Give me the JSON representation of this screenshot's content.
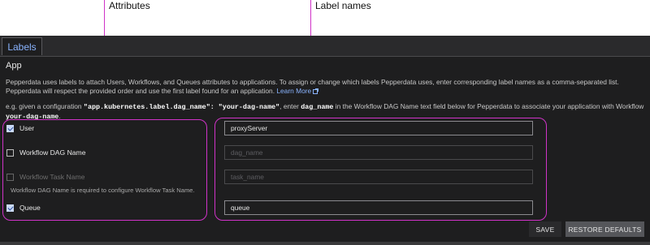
{
  "callouts": {
    "attributes": "Attributes",
    "label_names": "Label names"
  },
  "tabs": [
    {
      "label": "Labels",
      "active": true
    }
  ],
  "section": {
    "title": "App",
    "description_1": "Pepperdata uses labels to attach Users, Workflows, and Queues attributes to applications. To assign or change which labels Pepperdata uses, enter corresponding label names as a comma-separated list. Pepperdata will respect the provided order and use the first label found for an application.",
    "learn_more": "Learn More",
    "example": {
      "prefix": "e.g. given a configuration",
      "config_key": "\"app.kubernetes.label.dag_name\": \"your-dag-name\"",
      "middle_1": ", enter",
      "key_name": "dag_name",
      "middle_2": "in the Workflow DAG Name text field below for Pepperdata to associate your application with Workflow",
      "value_name": "your-dag-name",
      "suffix": "."
    }
  },
  "attributes": [
    {
      "label": "User",
      "checked": true,
      "disabled": false
    },
    {
      "label": "Workflow DAG Name",
      "checked": false,
      "disabled": false
    },
    {
      "label": "Workflow Task Name",
      "checked": false,
      "disabled": true
    },
    {
      "label": "Queue",
      "checked": true,
      "disabled": false
    }
  ],
  "task_name_hint": "Workflow DAG Name is required to configure Workflow Task Name.",
  "fields": [
    {
      "value": "proxyServer",
      "placeholder": ""
    },
    {
      "value": "",
      "placeholder": "dag_name"
    },
    {
      "value": "",
      "placeholder": "task_name"
    },
    {
      "value": "queue",
      "placeholder": ""
    }
  ],
  "buttons": {
    "save": "SAVE",
    "restore": "RESTORE DEFAULTS"
  },
  "colors": {
    "accent": "#d033c8",
    "link": "#8ab4ff",
    "background": "#1e1e1f"
  }
}
